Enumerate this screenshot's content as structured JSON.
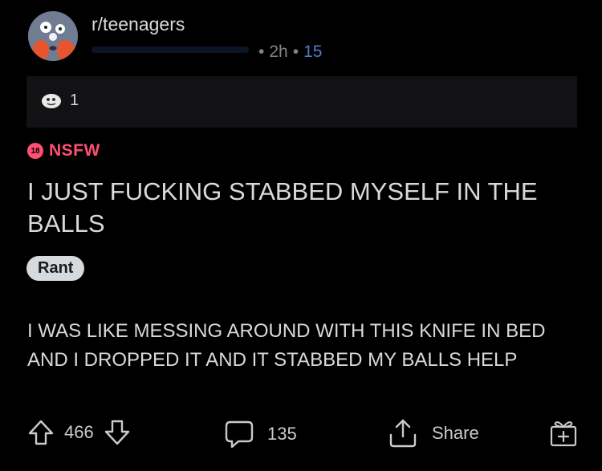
{
  "post": {
    "subreddit": "r/teenagers",
    "age": "2h",
    "meta_count": "15",
    "awards_count": "1",
    "nsfw_label": "NSFW",
    "nsfw_badge": "18",
    "title": "I JUST FUCKING STABBED MYSELF IN THE BALLS",
    "flair": "Rant",
    "body": "I WAS LIKE MESSING AROUND WITH THIS KNIFE IN BED AND I DROPPED IT AND IT STABBED MY BALLS HELP"
  },
  "actions": {
    "votes": "466",
    "comments": "135",
    "share_label": "Share"
  },
  "icons": {
    "upvote": "arrow-up-icon",
    "downvote": "arrow-down-icon",
    "comment": "comment-bubble-icon",
    "share": "share-icon",
    "award": "gift-icon"
  },
  "colors": {
    "background": "#000000",
    "nsfw": "#ff4f73",
    "meta_link": "#4f7ccc",
    "text": "#d7dadc"
  }
}
